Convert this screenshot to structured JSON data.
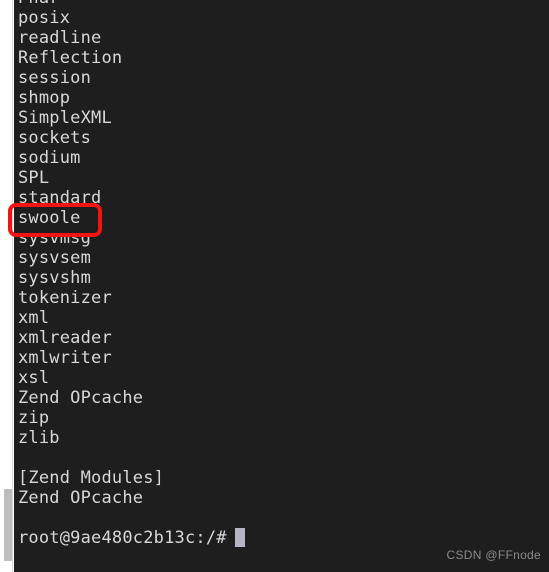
{
  "terminal": {
    "background_color": "#1e1e1e",
    "text_color": "#d8d8d8",
    "lines": [
      "Phar",
      "posix",
      "readline",
      "Reflection",
      "session",
      "shmop",
      "SimpleXML",
      "sockets",
      "sodium",
      "SPL",
      "standard",
      "swoole",
      "sysvmsg",
      "sysvsem",
      "sysvshm",
      "tokenizer",
      "xml",
      "xmlreader",
      "xmlwriter",
      "xsl",
      "Zend OPcache",
      "zip",
      "zlib",
      "",
      "[Zend Modules]",
      "Zend OPcache",
      ""
    ],
    "prompt": "root@9ae480c2b13c:/#",
    "cursor_color": "#b6b6c2"
  },
  "annotation": {
    "highlight_target": "swoole",
    "highlight_color": "#f21313"
  },
  "scrollbar": {
    "thumb_color": "#bdbdbd",
    "track_color": "#ffffff"
  },
  "watermark": {
    "text": "CSDN @FFnode"
  }
}
